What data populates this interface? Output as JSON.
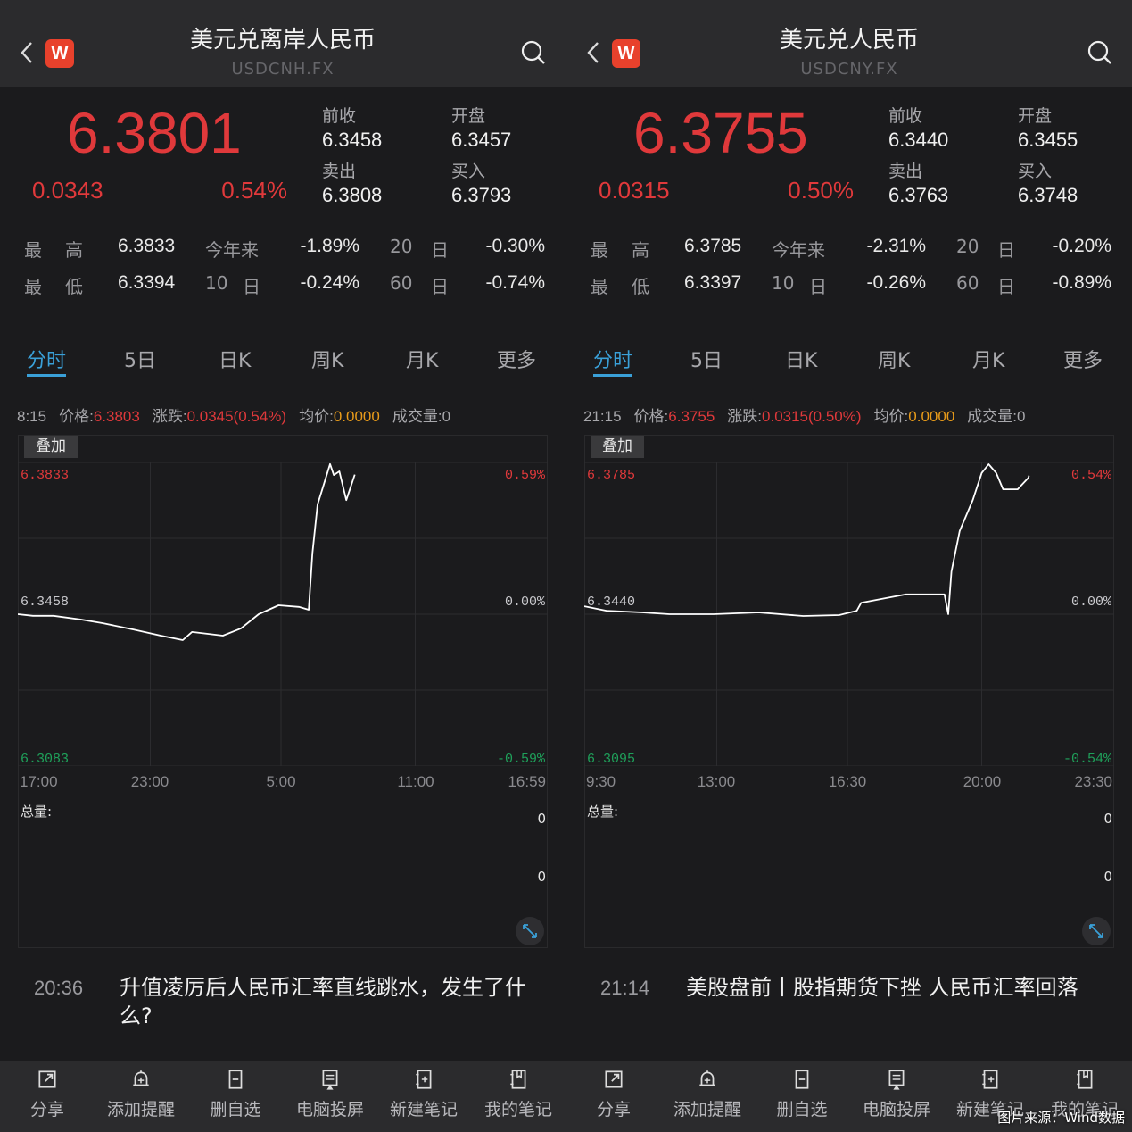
{
  "colors": {
    "up": "#e0393b",
    "down": "#1fa05a",
    "accent": "#3aa0d8",
    "avg": "#e89b1a",
    "logo": "#e8412c"
  },
  "logo_text": "W",
  "watermark": "图片来源：Wind数据",
  "panels": [
    {
      "title": "美元兑离岸人民币",
      "code": "USDCNH.FX",
      "price": "6.3801",
      "change": "0.0343",
      "change_pct": "0.54%",
      "quote": {
        "prev_close_label": "前收",
        "prev_close": "6.3458",
        "open_label": "开盘",
        "open": "6.3457",
        "ask_label": "卖出",
        "ask": "6.3808",
        "bid_label": "买入",
        "bid": "6.3793"
      },
      "stats": {
        "high_label": [
          "最",
          "高"
        ],
        "high": "6.3833",
        "low_label": [
          "最",
          "低"
        ],
        "low": "6.3394",
        "ytd_label": "今年来",
        "ytd": "-1.89%",
        "d10_label": [
          "10",
          "日"
        ],
        "d10": "-0.24%",
        "d20_label": [
          "20",
          "日"
        ],
        "d20": "-0.30%",
        "d60_label": [
          "60",
          "日"
        ],
        "d60": "-0.74%"
      },
      "tabs": [
        "分时",
        "5日",
        "日K",
        "周K",
        "月K",
        "更多"
      ],
      "active_tab": 0,
      "info": {
        "time": "8:15",
        "price_label": "价格:",
        "price": "6.3803",
        "change_label": "涨跌:",
        "change": "0.0345(0.54%)",
        "avg_label": "均价:",
        "avg": "0.0000",
        "volume_label": "成交量:",
        "volume": "0"
      },
      "overlay_label": "叠加",
      "volume_title": "总量:",
      "volume_ticks": [
        "0",
        "0"
      ],
      "news": {
        "time": "20:36",
        "title": "升值凌厉后人民币汇率直线跳水，发生了什么?"
      },
      "chart_data": {
        "type": "line",
        "x_ticks": [
          "17:00",
          "23:00",
          "5:00",
          "11:00",
          "16:59"
        ],
        "y_left_ticks": [
          "6.3833",
          "6.3458",
          "6.3083"
        ],
        "y_right_ticks": [
          "0.59%",
          "0.00%",
          "-0.59%"
        ],
        "ylim": [
          6.3083,
          6.3833
        ],
        "xlim": [
          "17:00",
          "16:59"
        ],
        "prev_close": 6.3458,
        "grid": true,
        "points": [
          [
            "17:00",
            6.3458
          ],
          [
            "17:41",
            6.3454
          ],
          [
            "18:37",
            6.3454
          ],
          [
            "19:50",
            6.3445
          ],
          [
            "20:50",
            6.3436
          ],
          [
            "22:15",
            6.342
          ],
          [
            "23:28",
            6.3405
          ],
          [
            "00:28",
            6.3394
          ],
          [
            "00:53",
            6.3414
          ],
          [
            "02:17",
            6.3405
          ],
          [
            "03:06",
            6.3423
          ],
          [
            "03:54",
            6.3458
          ],
          [
            "04:48",
            6.348
          ],
          [
            "05:43",
            6.3476
          ],
          [
            "06:10",
            6.3469
          ],
          [
            "06:20",
            6.3608
          ],
          [
            "06:34",
            6.3729
          ],
          [
            "06:49",
            6.3773
          ],
          [
            "07:08",
            6.3829
          ],
          [
            "07:18",
            6.3802
          ],
          [
            "07:33",
            6.3811
          ],
          [
            "07:52",
            6.374
          ],
          [
            "08:04",
            6.3773
          ],
          [
            "08:15",
            6.3803
          ]
        ]
      }
    },
    {
      "title": "美元兑人民币",
      "code": "USDCNY.FX",
      "price": "6.3755",
      "change": "0.0315",
      "change_pct": "0.50%",
      "quote": {
        "prev_close_label": "前收",
        "prev_close": "6.3440",
        "open_label": "开盘",
        "open": "6.3455",
        "ask_label": "卖出",
        "ask": "6.3763",
        "bid_label": "买入",
        "bid": "6.3748"
      },
      "stats": {
        "high_label": [
          "最",
          "高"
        ],
        "high": "6.3785",
        "low_label": [
          "最",
          "低"
        ],
        "low": "6.3397",
        "ytd_label": "今年来",
        "ytd": "-2.31%",
        "d10_label": [
          "10",
          "日"
        ],
        "d10": "-0.26%",
        "d20_label": [
          "20",
          "日"
        ],
        "d20": "-0.20%",
        "d60_label": [
          "60",
          "日"
        ],
        "d60": "-0.89%"
      },
      "tabs": [
        "分时",
        "5日",
        "日K",
        "周K",
        "月K",
        "更多"
      ],
      "active_tab": 0,
      "info": {
        "time": "21:15",
        "price_label": "价格:",
        "price": "6.3755",
        "change_label": "涨跌:",
        "change": "0.0315(0.50%)",
        "avg_label": "均价:",
        "avg": "0.0000",
        "volume_label": "成交量:",
        "volume": "0"
      },
      "overlay_label": "叠加",
      "volume_title": "总量:",
      "volume_ticks": [
        "0",
        "0"
      ],
      "news": {
        "time": "21:14",
        "title": "美股盘前丨股指期货下挫 人民币汇率回落"
      },
      "chart_data": {
        "type": "line",
        "x_ticks": [
          "9:30",
          "13:00",
          "16:30",
          "20:00",
          "23:30"
        ],
        "y_left_ticks": [
          "6.3785",
          "6.3440",
          "6.3095"
        ],
        "y_right_ticks": [
          "0.54%",
          "0.00%",
          "-0.54%"
        ],
        "ylim": [
          6.3095,
          6.3785
        ],
        "xlim": [
          "9:30",
          "23:30"
        ],
        "prev_close": 6.344,
        "grid": true,
        "points": [
          [
            "09:30",
            6.3458
          ],
          [
            "10:05",
            6.3448
          ],
          [
            "11:02",
            6.3444
          ],
          [
            "11:45",
            6.344
          ],
          [
            "12:55",
            6.344
          ],
          [
            "14:06",
            6.3444
          ],
          [
            "15:17",
            6.3436
          ],
          [
            "16:14",
            6.3438
          ],
          [
            "16:42",
            6.3448
          ],
          [
            "16:49",
            6.3466
          ],
          [
            "18:00",
            6.3485
          ],
          [
            "19:01",
            6.3485
          ],
          [
            "19:07",
            6.344
          ],
          [
            "19:12",
            6.3537
          ],
          [
            "19:25",
            6.3629
          ],
          [
            "19:46",
            6.37
          ],
          [
            "20:00",
            6.3761
          ],
          [
            "20:11",
            6.3781
          ],
          [
            "20:23",
            6.3761
          ],
          [
            "20:34",
            6.3724
          ],
          [
            "20:57",
            6.3724
          ],
          [
            "21:14",
            6.375
          ],
          [
            "21:15",
            6.3755
          ]
        ]
      }
    }
  ],
  "toolbar": [
    {
      "label": "分享",
      "icon": "share-icon"
    },
    {
      "label": "添加提醒",
      "icon": "alarm-add-icon"
    },
    {
      "label": "删自选",
      "icon": "remove-watchlist-icon"
    },
    {
      "label": "电脑投屏",
      "icon": "screen-cast-icon"
    },
    {
      "label": "新建笔记",
      "icon": "new-note-icon"
    },
    {
      "label": "我的笔记",
      "icon": "my-notes-icon"
    }
  ]
}
